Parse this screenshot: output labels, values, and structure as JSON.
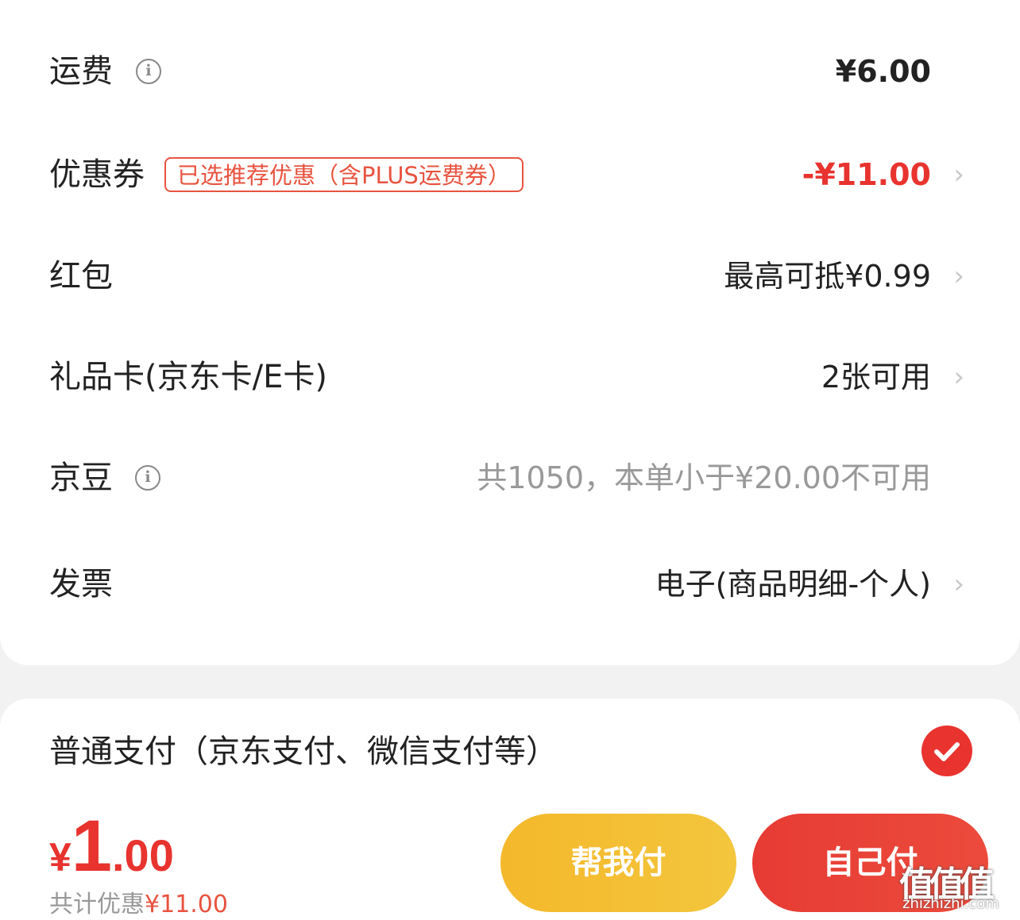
{
  "rows": {
    "freight": {
      "label": "运费",
      "value": "¥6.00"
    },
    "coupon": {
      "label": "优惠券",
      "tag": "已选推荐优惠（含PLUS运费券）",
      "value": "-¥11.00"
    },
    "redpacket": {
      "label": "红包",
      "value": "最高可抵¥0.99"
    },
    "giftcard": {
      "label": "礼品卡(京东卡/E卡)",
      "value": "2张可用"
    },
    "jingdou": {
      "label": "京豆",
      "value": "共1050，本单小于¥20.00不可用"
    },
    "invoice": {
      "label": "发票",
      "value": "电子(商品明细-个人)"
    }
  },
  "payment": {
    "label": "普通支付（京东支付、微信支付等）",
    "selected": true
  },
  "bottom_bar": {
    "currency": "¥",
    "total_int": "1",
    "total_dec": ".00",
    "saved_prefix": "共计优惠",
    "saved_amount": "¥11.00",
    "help_pay_label": "帮我付",
    "self_pay_label": "自己付"
  },
  "watermark": {
    "glyphs": "值值值",
    "url": "zhizhizhi.com"
  },
  "icons": {
    "info": "info-icon",
    "chevron": "chevron-right-icon",
    "check": "check-icon"
  },
  "colors": {
    "accent_red": "#e8332f",
    "help_yellow": "#f4b82b",
    "text_gray": "#999999"
  }
}
